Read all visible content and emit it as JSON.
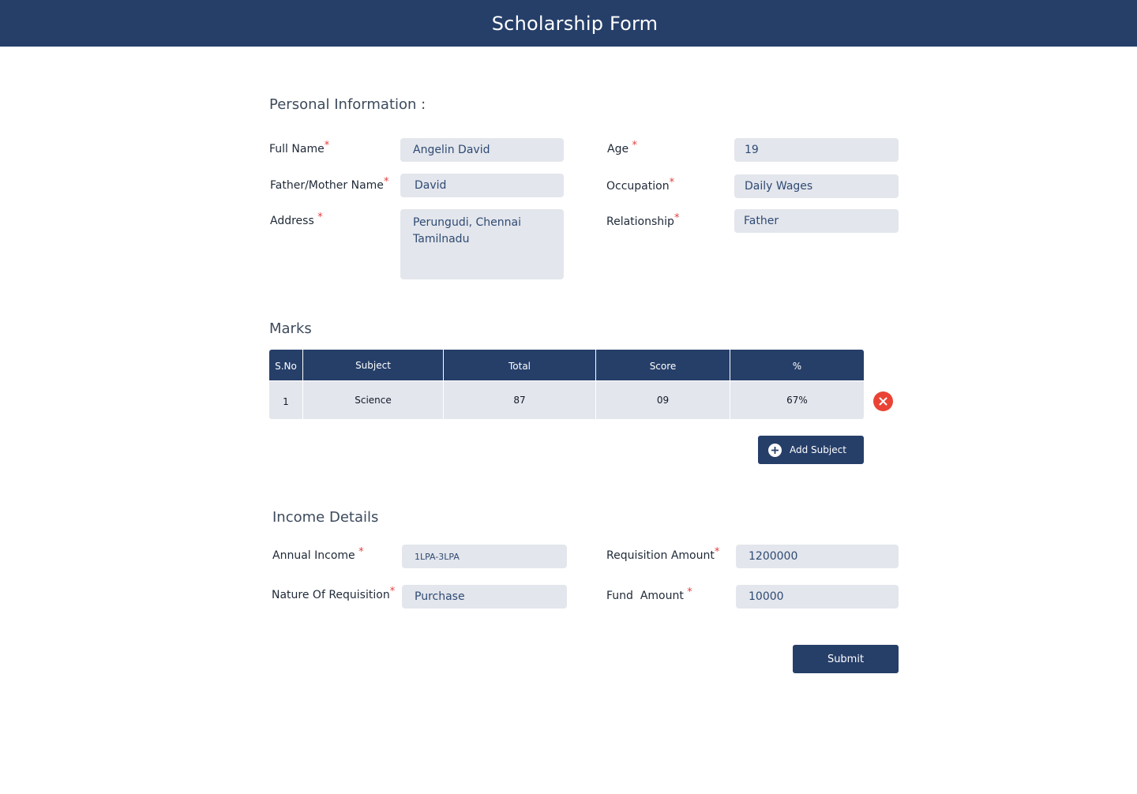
{
  "header": {
    "title": "Scholarship Form"
  },
  "personal": {
    "section_title": "Personal Information :",
    "full_name": {
      "label": "Full Name",
      "required": "*",
      "value": "Angelin David"
    },
    "parent_name": {
      "label": "Father/Mother Name",
      "required": "*",
      "value": "David"
    },
    "address": {
      "label": "Address ",
      "required": "*",
      "value": "Perungudi, Chennai\nTamilnadu"
    },
    "age": {
      "label": "Age ",
      "required": "*",
      "value": "19"
    },
    "occupation": {
      "label": "Occupation",
      "required": "*",
      "value": "Daily Wages"
    },
    "relationship": {
      "label": "Relationship",
      "required": "*",
      "value": "Father"
    }
  },
  "marks": {
    "section_title": "Marks",
    "columns": [
      "S.No",
      "Subject",
      "Total",
      "Score",
      "%"
    ],
    "rows": [
      {
        "sno": "1",
        "subject": "Science",
        "total": "87",
        "score": "09",
        "percent": "67%"
      }
    ],
    "add_subject_label": "Add Subject"
  },
  "income": {
    "section_title": "Income Details",
    "annual_income": {
      "label": "Annual Income ",
      "required": "*",
      "value": "1LPA-3LPA"
    },
    "nature_of_requisition": {
      "label": "Nature Of Requisition",
      "required": "*",
      "value": "Purchase"
    },
    "requisition_amount": {
      "label": "Requisition Amount",
      "required": "*",
      "value": "1200000"
    },
    "fund_amount": {
      "label": "Fund  Amount ",
      "required": "*",
      "value": "10000"
    }
  },
  "submit_label": "Submit",
  "colors": {
    "primary": "#263f69",
    "field_bg": "#e3e6ec",
    "required": "#e53e3e",
    "delete": "#ea4335"
  }
}
